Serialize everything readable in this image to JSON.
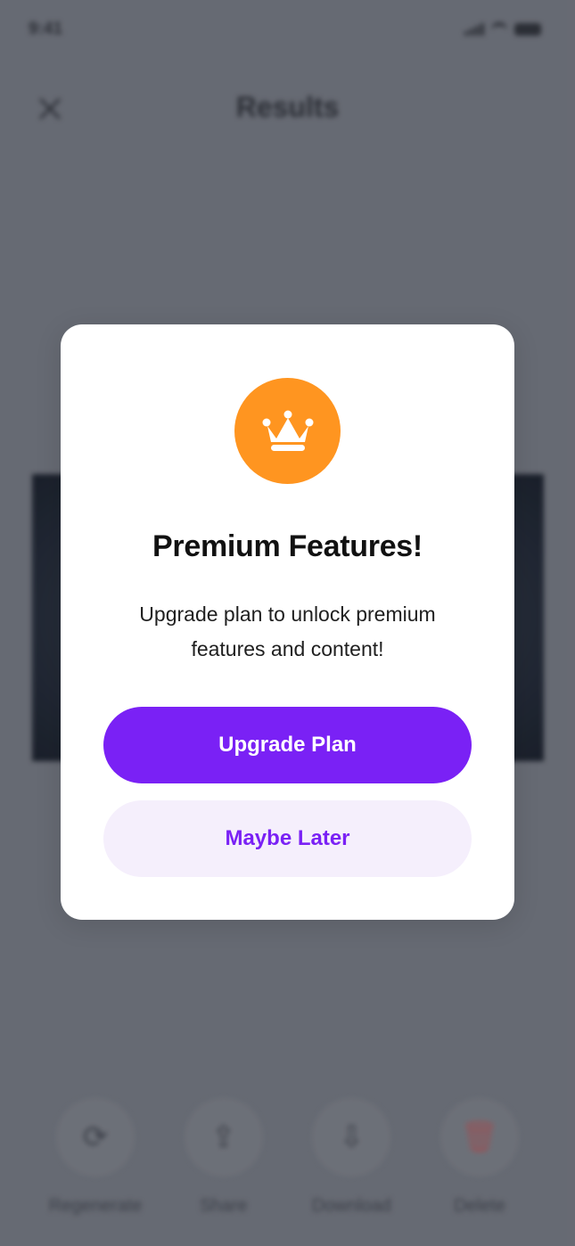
{
  "status_bar": {
    "time": "9:41"
  },
  "header": {
    "title": "Results"
  },
  "actions": [
    {
      "label": "Regenerate",
      "icon": "regenerate-icon"
    },
    {
      "label": "Share",
      "icon": "share-icon"
    },
    {
      "label": "Download",
      "icon": "download-icon"
    },
    {
      "label": "Delete",
      "icon": "trash-icon"
    }
  ],
  "modal": {
    "icon": "crown-icon",
    "badge_color": "#FF9520",
    "title": "Premium Features!",
    "description": "Upgrade plan to unlock premium features and content!",
    "primary_label": "Upgrade Plan",
    "secondary_label": "Maybe Later",
    "accent_color": "#7A21F5"
  }
}
